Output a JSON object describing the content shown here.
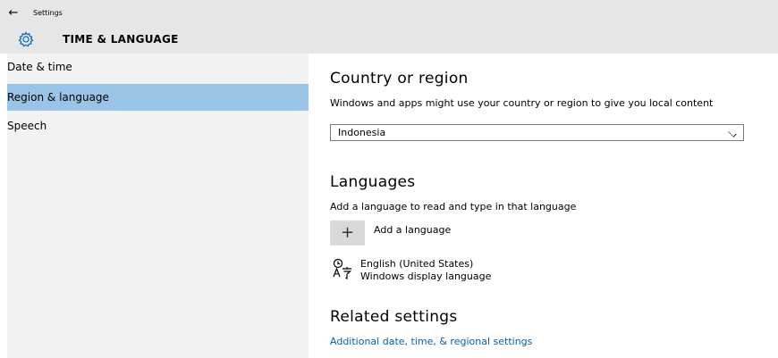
{
  "header": {
    "back_icon": "back-arrow-icon",
    "back_glyph": "←",
    "app_title": "Settings",
    "section_icon": "gear-icon",
    "section_title": "TIME & LANGUAGE",
    "background": "#e6e6e6"
  },
  "sidebar": {
    "background": "#f2f2f2",
    "selected_color": "#99c4e8",
    "items": [
      {
        "label": "Date & time",
        "selected": false
      },
      {
        "label": "Region & language",
        "selected": true
      },
      {
        "label": "Speech",
        "selected": false
      }
    ]
  },
  "country": {
    "heading": "Country or region",
    "description": "Windows and apps might use your country or region to give you local content",
    "selected_value": "Indonesia"
  },
  "languages": {
    "heading": "Languages",
    "description": "Add a language to read and type in that language",
    "add_glyph": "+",
    "add_label": "Add a language",
    "entries": [
      {
        "icon": "language-icon",
        "name": "English (United States)",
        "detail": "Windows display language"
      }
    ]
  },
  "related": {
    "heading": "Related settings",
    "link_text": "Additional date, time, & regional settings",
    "link_color": "#0063b1"
  }
}
